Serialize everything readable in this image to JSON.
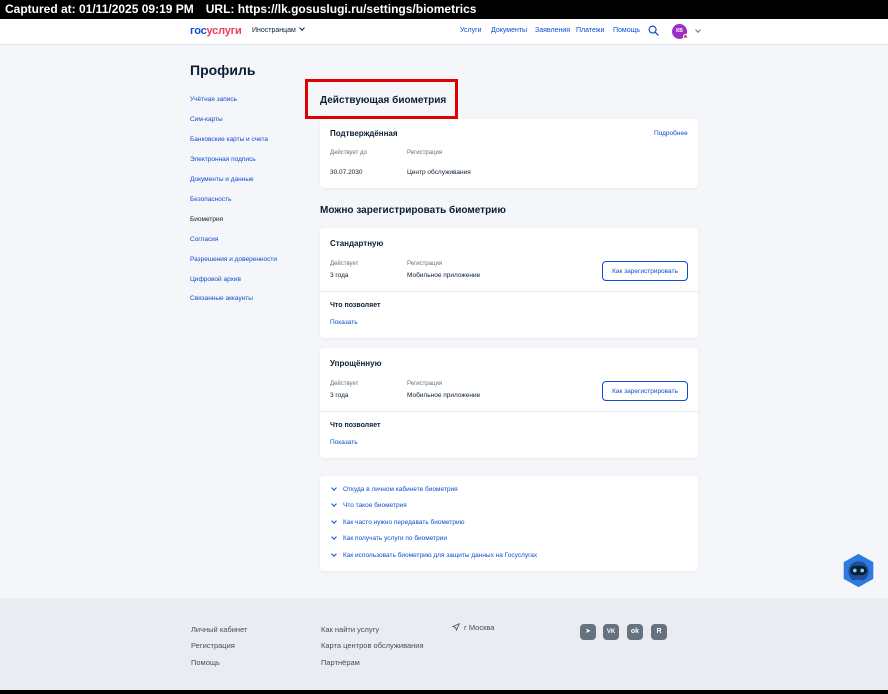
{
  "capture": {
    "captured": "Captured at: 01/11/2025 09:19 PM",
    "url": "URL: https://lk.gosuslugi.ru/settings/biometrics"
  },
  "header": {
    "logo_part1": "гос",
    "logo_part2": "услуги",
    "lang": "Иностранцам",
    "nav": [
      "Услуги",
      "Документы",
      "Заявления",
      "Платежи",
      "Помощь"
    ],
    "avatar_initials": "КВ"
  },
  "sidebar": {
    "title": "Профиль",
    "items": [
      {
        "label": "Учётная запись"
      },
      {
        "label": "Сим-карты"
      },
      {
        "label": "Банковские карты и счета"
      },
      {
        "label": "Электронная подпись"
      },
      {
        "label": "Документы и данные"
      },
      {
        "label": "Безопасность"
      },
      {
        "label": "Биометрия"
      },
      {
        "label": "Согласия"
      },
      {
        "label": "Разрешения и доверенности"
      },
      {
        "label": "Цифровой архив"
      },
      {
        "label": "Связанные аккаунты"
      }
    ]
  },
  "current": {
    "heading": "Действующая биометрия",
    "card": {
      "title": "Подтверждённая",
      "more": "Подробнее",
      "valid_label": "Действует до",
      "reg_label": "Регистрация",
      "valid_value": "30.07.2030",
      "reg_value": "Центр обслуживания"
    }
  },
  "register": {
    "heading": "Можно зарегистрировать биометрию",
    "cards": [
      {
        "title": "Стандартную",
        "valid_label": "Действует",
        "valid_value": "3 года",
        "reg_label": "Регистрация",
        "reg_value": "Мобильное приложение",
        "button": "Как зарегистрировать",
        "allows": "Что позволяет",
        "show": "Показать"
      },
      {
        "title": "Упрощённую",
        "valid_label": "Действует",
        "valid_value": "3 года",
        "reg_label": "Регистрация",
        "reg_value": "Мобильное приложение",
        "button": "Как зарегистрировать",
        "allows": "Что позволяет",
        "show": "Показать"
      }
    ]
  },
  "faq": [
    {
      "label": "Откуда в личном кабинете биометрия"
    },
    {
      "label": "Что такое биометрия"
    },
    {
      "label": "Как часто нужно передавать биометрию"
    },
    {
      "label": "Как получать услуги по биометрии"
    },
    {
      "label": "Как использовать биометрию для защиты данных на Госуслугах"
    }
  ],
  "footer": {
    "col1": [
      "Личный кабинет",
      "Регистрация",
      "Помощь"
    ],
    "col2": [
      "Как найти услугу",
      "Карта центров обслуживания",
      "Партнёрам"
    ],
    "city": "г Москва",
    "social": [
      {
        "icon": "telegram-icon",
        "glyph": "➤"
      },
      {
        "icon": "vk-icon",
        "glyph": "VK"
      },
      {
        "icon": "odnoklassniki-icon",
        "glyph": "ok"
      },
      {
        "icon": "rutube-icon",
        "glyph": "R"
      }
    ]
  },
  "colors": {
    "link": "#0d4cd3",
    "text": "#0b1f33",
    "muted": "#66727f",
    "page_bg": "#f4f6f9",
    "highlight": "#e00000",
    "footer_bg": "#e9edf1"
  }
}
